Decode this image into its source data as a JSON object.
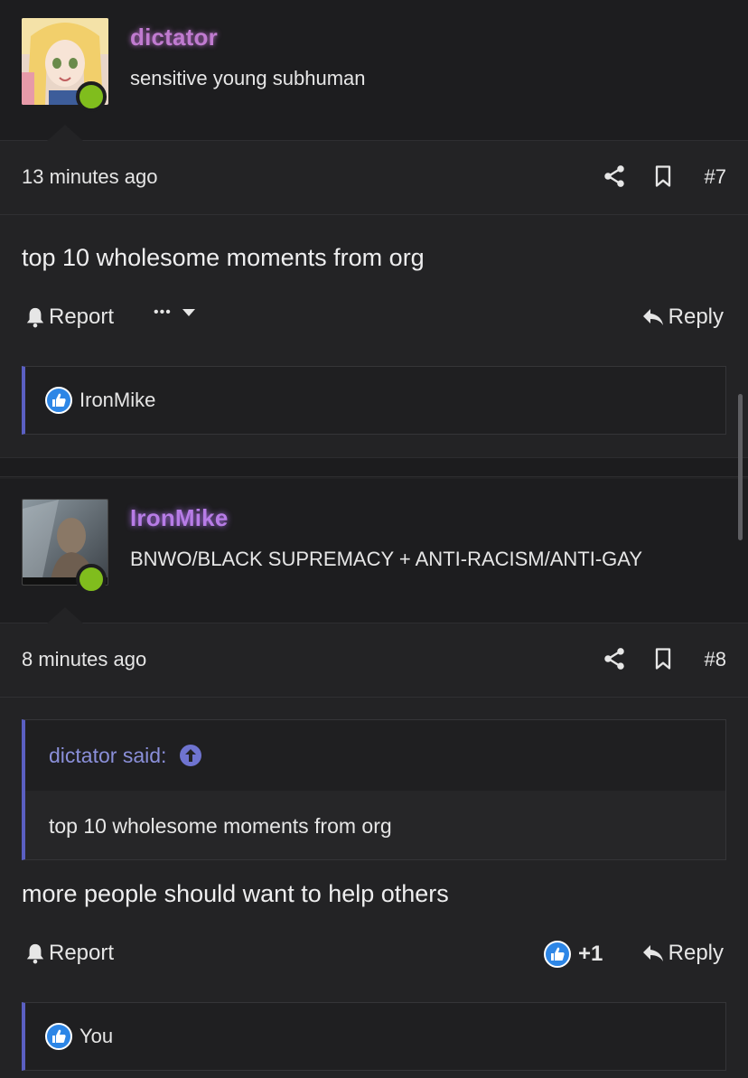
{
  "posts": [
    {
      "username": "dictator",
      "user_title": "sensitive young subhuman",
      "time": "13 minutes ago",
      "number": "#7",
      "body": "top 10 wholesome moments from org",
      "report_label": "Report",
      "more_label": "•••",
      "reply_label": "Reply",
      "reactions_user": "IronMike"
    },
    {
      "username": "IronMike",
      "user_title": "BNWO/BLACK SUPREMACY + ANTI-RACISM/ANTI-GAY",
      "time": "8 minutes ago",
      "number": "#8",
      "quote_author": "dictator said:",
      "quote_text": "top 10 wholesome moments from org",
      "body": "more people should want to help others",
      "report_label": "Report",
      "like_count": "+1",
      "reply_label": "Reply",
      "reactions_user": "You"
    }
  ],
  "icons": {
    "share": "share-icon",
    "bookmark": "bookmark-icon",
    "bell": "bell-icon",
    "reply": "reply-arrow-icon",
    "like": "thumbs-up-icon",
    "quote_up": "arrow-up-circle-icon"
  },
  "colors": {
    "background": "#232325",
    "user_block": "#1d1d1f",
    "online": "#80bd1d",
    "accent": "#5a5fc2",
    "like_blue": "#2d86e6"
  }
}
